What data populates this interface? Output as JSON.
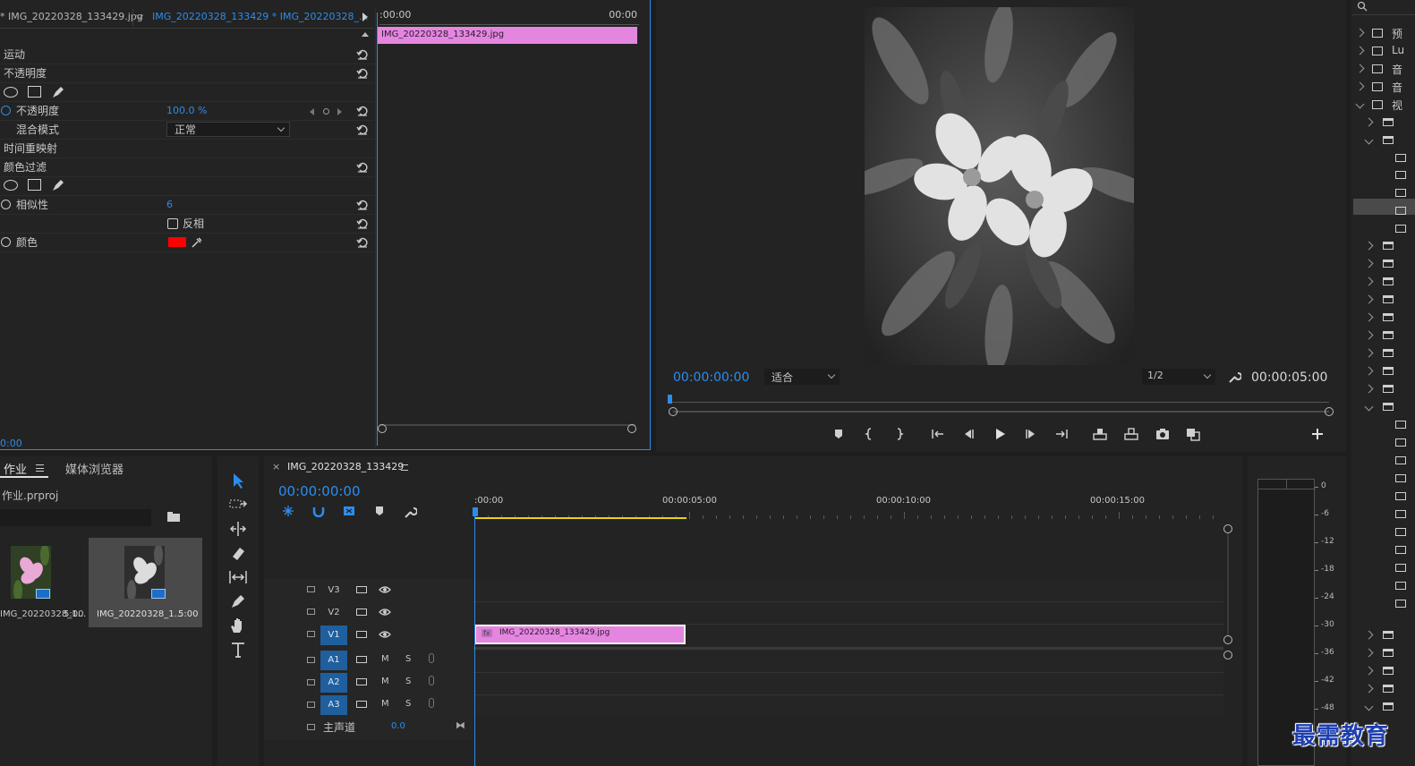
{
  "effect_controls": {
    "tab1": "* IMG_20220328_133429.jpg",
    "tab2": "IMG_20220328_133429 * IMG_20220328_...",
    "ruler_start": ":00:00",
    "ruler_end": "00:00",
    "clip_label": "IMG_20220328_133429.jpg",
    "rows": {
      "motion": "运动",
      "opacity_group": "不透明度",
      "opacity": "不透明度",
      "opacity_value": "100.0 %",
      "blend_mode": "混合模式",
      "blend_value": "正常",
      "time_remap": "时间重映射",
      "color_key": "颜色过滤",
      "similarity": "相似性",
      "similarity_value": "6",
      "invert": "反相",
      "color": "颜色"
    },
    "timecode": "0:00",
    "key_color": "#ff0000"
  },
  "program_monitor": {
    "timecode": "00:00:00:00",
    "zoom": "适合",
    "resolution": "1/2",
    "duration": "00:00:05:00"
  },
  "project": {
    "tab_project": "作业",
    "tab_media_browser": "媒体浏览器",
    "file_name": "作业.prproj",
    "items": [
      {
        "name": "IMG_20220328_1...",
        "duration": "5:00"
      },
      {
        "name": "IMG_20220328_1...",
        "duration": "5:00"
      }
    ]
  },
  "timeline": {
    "sequence_name": "IMG_20220328_133429",
    "timecode": "00:00:00:00",
    "ruler_labels": [
      ":00:00",
      "00:00:05:00",
      "00:00:10:00",
      "00:00:15:00"
    ],
    "tracks": {
      "v3": "V3",
      "v2": "V2",
      "v1": "V1",
      "a1": "A1",
      "a2": "A2",
      "a3": "A3",
      "m": "M",
      "s": "S",
      "master": "主声道",
      "master_value": "0.0"
    },
    "clip_label": "IMG_20220328_133429.jpg",
    "clip_color": "#e486e0"
  },
  "meter_labels": [
    "0",
    "-6",
    "-12",
    "-18",
    "-24",
    "-30",
    "-36",
    "-42",
    "-48"
  ],
  "effects_panel": {
    "items": [
      "预",
      "Lu",
      "音",
      "音",
      "视"
    ]
  },
  "watermark": "最需教育"
}
